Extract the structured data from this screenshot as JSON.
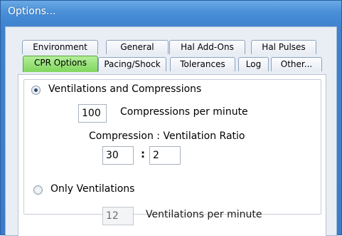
{
  "window": {
    "title": "Options..."
  },
  "tabs_row1": [
    "Environment",
    "General",
    "Hal Add-Ons",
    "Hal Pulses"
  ],
  "tabs_row2": [
    "CPR Options",
    "Pacing/Shock",
    "Tolerances",
    "Log",
    "Other..."
  ],
  "active_tab": "CPR Options",
  "cpr": {
    "mode_both_label": "Ventilations and Compressions",
    "mode_both_selected": true,
    "compressions_value": "100",
    "compressions_label": "Compressions per minute",
    "ratio_label": "Compression : Ventilation Ratio",
    "ratio_compression_value": "30",
    "ratio_separator": ":",
    "ratio_ventilation_value": "2",
    "mode_vent_only_label": "Only Ventilations",
    "mode_vent_only_selected": false,
    "ventilations_value": "12",
    "ventilations_label": "Ventilations per minute"
  }
}
